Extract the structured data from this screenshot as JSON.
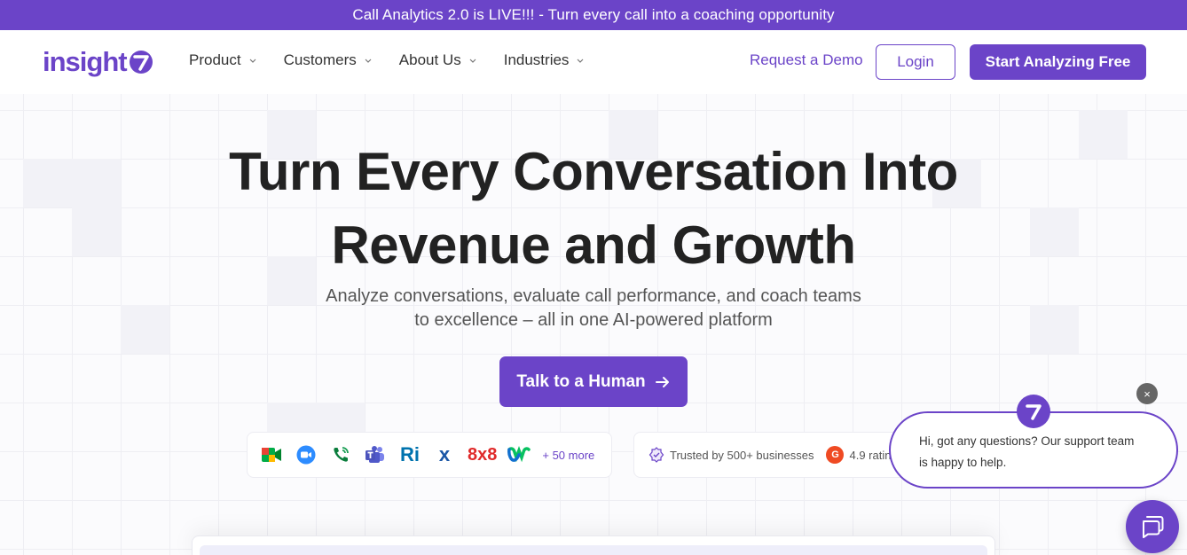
{
  "banner": {
    "text": "Call Analytics 2.0 is LIVE!!! - Turn every call into a coaching opportunity"
  },
  "nav": {
    "logo_text": "insight",
    "menu": [
      {
        "label": "Product"
      },
      {
        "label": "Customers"
      },
      {
        "label": "About Us"
      },
      {
        "label": "Industries"
      }
    ],
    "request_demo": "Request a Demo",
    "login": "Login",
    "start_free": "Start Analyzing Free"
  },
  "hero": {
    "headline_line1": "Turn Every Conversation Into",
    "headline_line2": "Revenue and Growth",
    "subhead_line1": "Analyze conversations, evaluate call performance, and coach teams",
    "subhead_line2": "to excellence – all in one AI-powered platform",
    "cta": "Talk to a Human"
  },
  "integrations": {
    "icons": [
      "google-meet-icon",
      "zoom-icon",
      "phone-icon",
      "teams-icon",
      "ringcentral-icon",
      "x-icon",
      "8x8-icon",
      "webex-icon"
    ],
    "eight_by_eight": "8x8",
    "ri_label": "Ri",
    "x_label": "x",
    "more": "+ 50 more"
  },
  "trust": {
    "businesses": "Trusted by 500+ businesses",
    "g2_label": "G",
    "rating": "4.9 rating"
  },
  "chat": {
    "message_line1": "Hi, got any questions? Our support team",
    "message_line2": "is happy to help.",
    "close": "×"
  },
  "colors": {
    "brand": "#6b44c8",
    "banner_bg": "#6b44c8",
    "text_dark": "#222222"
  }
}
